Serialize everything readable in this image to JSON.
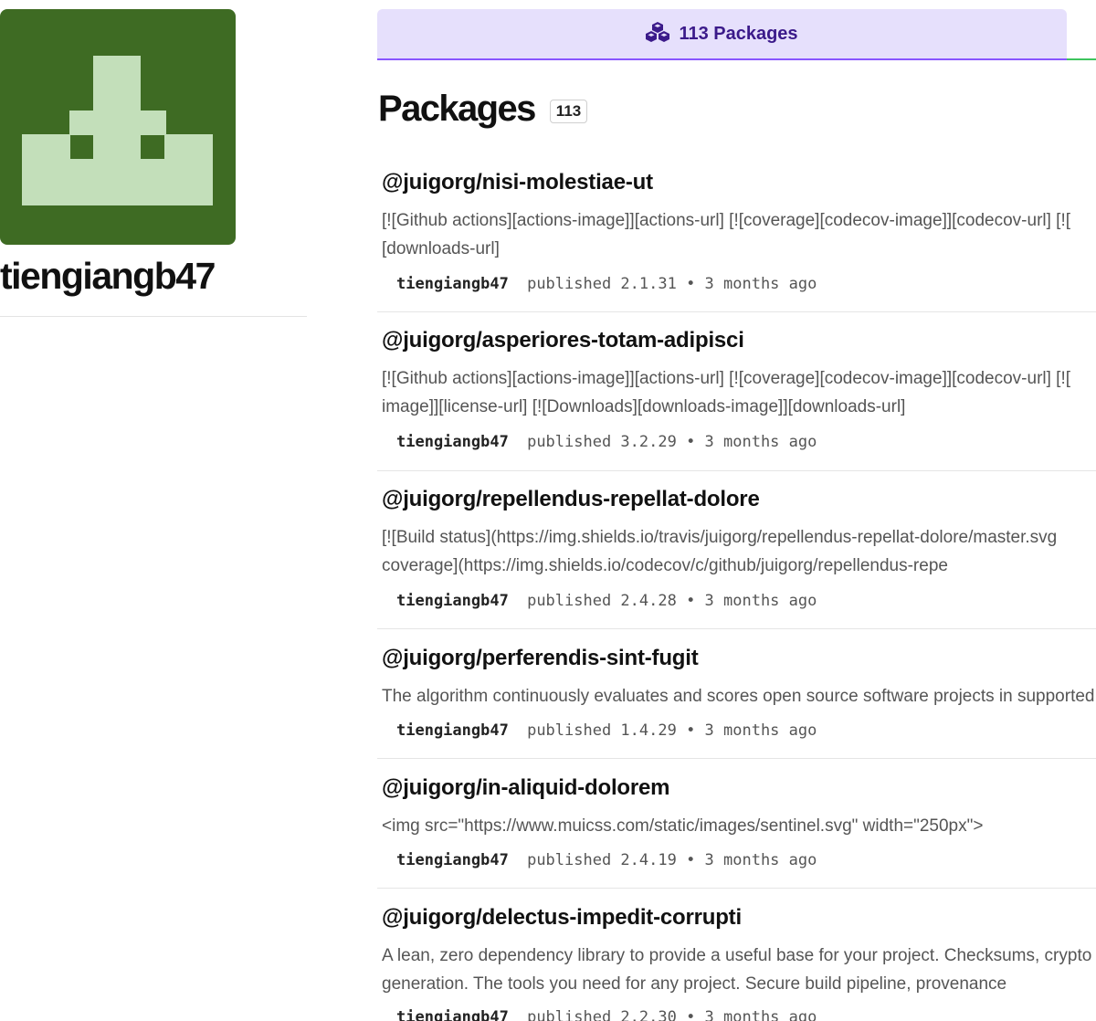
{
  "profile": {
    "username": "tiengiangb47",
    "avatar_colors": {
      "background": "#3e6b23",
      "foreground": "#c3dfba"
    }
  },
  "tabs": [
    {
      "label": "113 Packages",
      "icon": "packages-cubes-icon",
      "active": true,
      "color": "#3b1a8a",
      "background": "#e6e0fc"
    }
  ],
  "packages_section": {
    "title": "Packages",
    "count": "113"
  },
  "packages": [
    {
      "name": "@juigorg/nisi-molestiae-ut",
      "description_lines": [
        "[![Github actions][actions-image]][actions-url] [![coverage][codecov-image]][codecov-url] [![",
        "[downloads-url]"
      ],
      "publisher": "tiengiangb47",
      "meta": "published 2.1.31 • 3 months ago"
    },
    {
      "name": "@juigorg/asperiores-totam-adipisci",
      "description_lines": [
        "[![Github actions][actions-image]][actions-url] [![coverage][codecov-image]][codecov-url] [![",
        "image]][license-url] [![Downloads][downloads-image]][downloads-url]"
      ],
      "publisher": "tiengiangb47",
      "meta": "published 3.2.29 • 3 months ago"
    },
    {
      "name": "@juigorg/repellendus-repellat-dolore",
      "description_lines": [
        "[![Build status](https://img.shields.io/travis/juigorg/repellendus-repellat-dolore/master.svg",
        "coverage](https://img.shields.io/codecov/c/github/juigorg/repellendus-repe"
      ],
      "publisher": "tiengiangb47",
      "meta": "published 2.4.28 • 3 months ago"
    },
    {
      "name": "@juigorg/perferendis-sint-fugit",
      "description_lines": [
        "The algorithm continuously evaluates and scores open source software projects in supported"
      ],
      "publisher": "tiengiangb47",
      "meta": "published 1.4.29 • 3 months ago"
    },
    {
      "name": "@juigorg/in-aliquid-dolorem",
      "description_lines": [
        "<img src=\"https://www.muicss.com/static/images/sentinel.svg\" width=\"250px\">"
      ],
      "publisher": "tiengiangb47",
      "meta": "published 2.4.19 • 3 months ago"
    },
    {
      "name": "@juigorg/delectus-impedit-corrupti",
      "description_lines": [
        "A lean, zero dependency library to provide a useful base for your project. Checksums, crypto",
        "generation. The tools you need for any project. Secure build pipeline, provenance"
      ],
      "publisher": "tiengiangb47",
      "meta": "published 2.2.30 • 3 months ago"
    }
  ]
}
